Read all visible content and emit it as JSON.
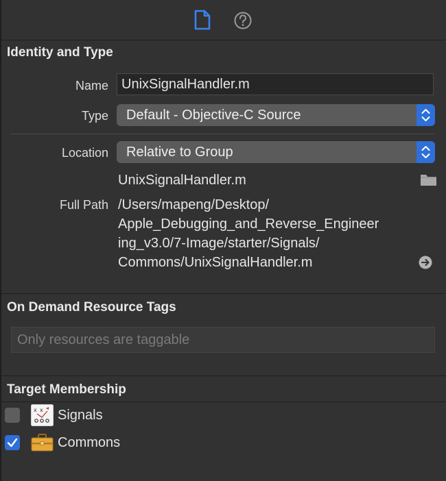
{
  "identity": {
    "section_title": "Identity and Type",
    "name_label": "Name",
    "name_value": "UnixSignalHandler.m",
    "type_label": "Type",
    "type_value": "Default - Objective-C Source",
    "location_label": "Location",
    "location_value": "Relative to Group",
    "file_name": "UnixSignalHandler.m",
    "full_path_label": "Full Path",
    "full_path_lines": [
      "/Users/mapeng/Desktop/",
      "Apple_Debugging_and_Reverse_Engineer",
      "ing_v3.0/7-Image/starter/Signals/",
      "Commons/UnixSignalHandler.m"
    ]
  },
  "on_demand": {
    "section_title": "On Demand Resource Tags",
    "placeholder": "Only resources are taggable"
  },
  "target_membership": {
    "section_title": "Target Membership",
    "targets": [
      {
        "name": "Signals",
        "checked": false,
        "icon": "app-target-icon"
      },
      {
        "name": "Commons",
        "checked": true,
        "icon": "framework-toolbox-icon"
      }
    ]
  },
  "toolbar": {
    "tabs": [
      {
        "icon": "file-inspector-icon",
        "active": true
      },
      {
        "icon": "quick-help-icon",
        "active": false
      }
    ]
  },
  "colors": {
    "background": "#323232",
    "accent": "#2f6fd8",
    "text": "#e6e6e6",
    "placeholder": "#7a7a7a"
  }
}
